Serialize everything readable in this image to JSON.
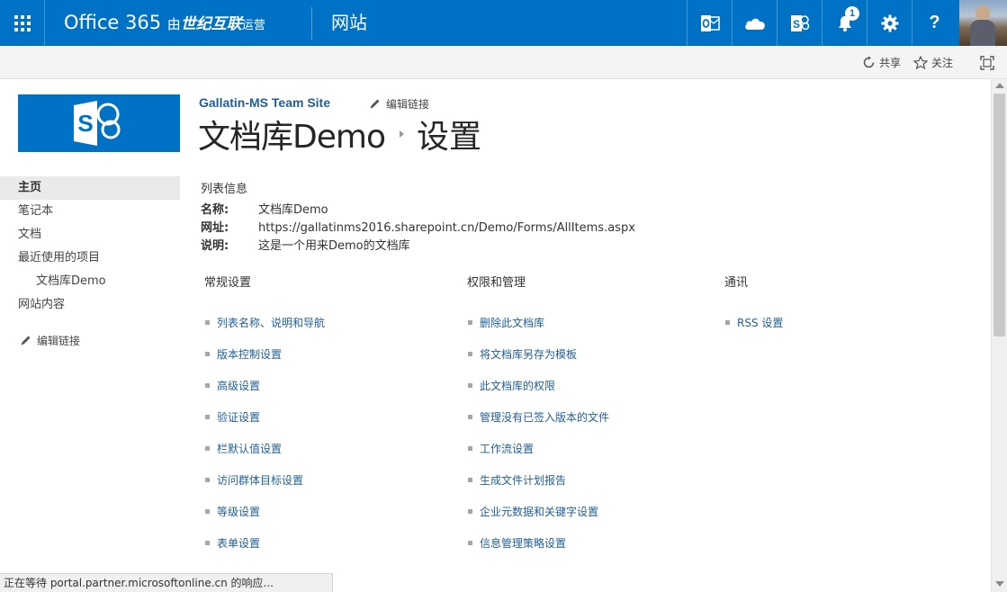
{
  "suite": {
    "brand_prefix": "Office 365",
    "brand_by": "由",
    "brand_partner": "世纪互联",
    "brand_suffix": "运营",
    "app_name": "网站",
    "notification_count": "1",
    "help_label": "?",
    "accent_color": "#0072c6"
  },
  "ribbon": {
    "share_label": "共享",
    "follow_label": "关注"
  },
  "header": {
    "site_title": "Gallatin-MS Team Site",
    "edit_links": "编辑链接",
    "library_name": "文档库Demo",
    "page_title": "设置"
  },
  "leftnav": {
    "items": [
      {
        "label": "主页"
      },
      {
        "label": "笔记本"
      },
      {
        "label": "文档"
      },
      {
        "label": "最近使用的项目"
      },
      {
        "label": "文档库Demo"
      },
      {
        "label": "网站内容"
      }
    ],
    "edit_links": "编辑链接"
  },
  "list_info": {
    "title": "列表信息",
    "rows": [
      {
        "key": "名称:",
        "value": "文档库Demo"
      },
      {
        "key": "网址:",
        "value": "https://gallatinms2016.sharepoint.cn/Demo/Forms/AllItems.aspx"
      },
      {
        "key": "说明:",
        "value": "这是一个用来Demo的文档库"
      }
    ]
  },
  "columns": {
    "general": {
      "title": "常规设置",
      "links": [
        "列表名称、说明和导航",
        "版本控制设置",
        "高级设置",
        "验证设置",
        "栏默认值设置",
        "访问群体目标设置",
        "等级设置",
        "表单设置"
      ]
    },
    "permissions": {
      "title": "权限和管理",
      "links": [
        "删除此文档库",
        "将文档库另存为模板",
        "此文档库的权限",
        "管理没有已签入版本的文件",
        "工作流设置",
        "生成文件计划报告",
        "企业元数据和关键字设置",
        "信息管理策略设置"
      ]
    },
    "communications": {
      "title": "通讯",
      "links": [
        "RSS 设置"
      ]
    }
  },
  "status": {
    "text": "正在等待 portal.partner.microsoftonline.cn 的响应..."
  }
}
